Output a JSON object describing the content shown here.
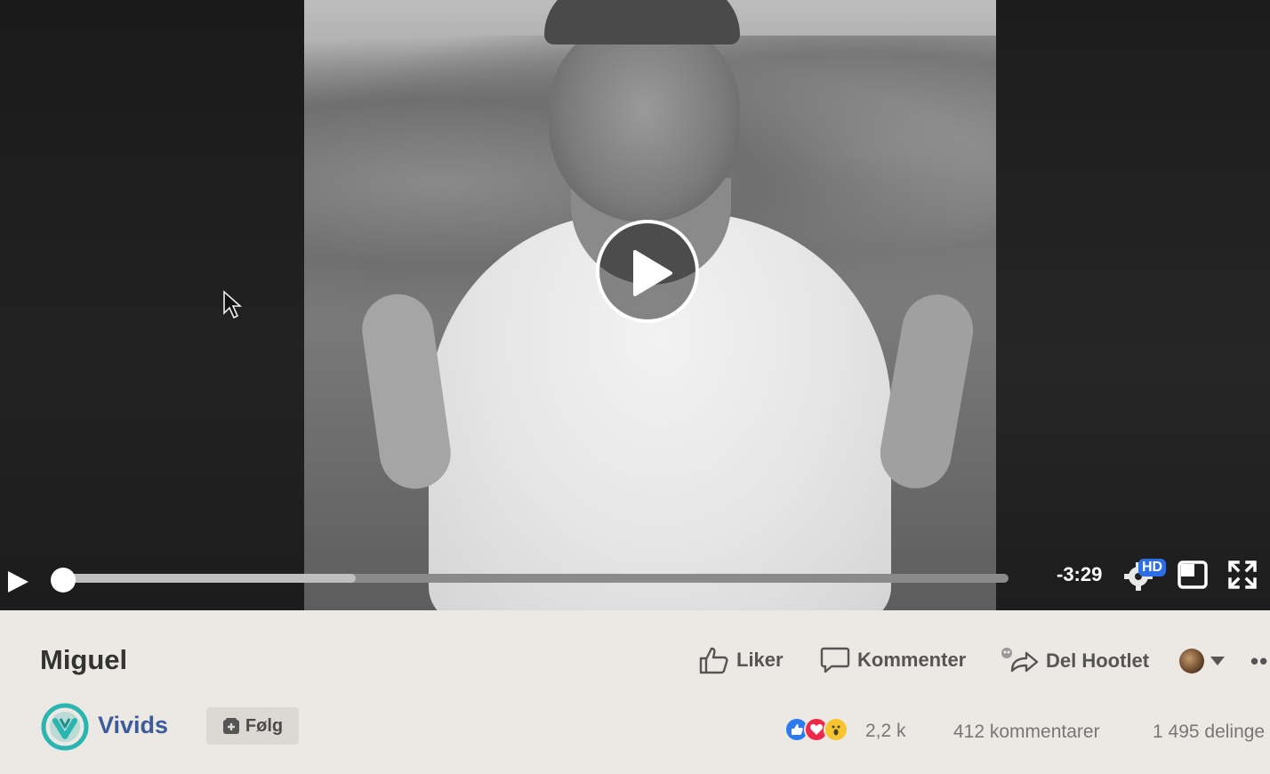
{
  "video": {
    "time_remaining": "-3:29",
    "hd_label": "HD",
    "progress_fraction": 0.0,
    "buffered_fraction": 0.31
  },
  "post": {
    "title": "Miguel",
    "actions": {
      "like": "Liker",
      "comment": "Kommenter",
      "share": "Del Hootlet"
    }
  },
  "page": {
    "name": "Vivids",
    "follow_label": "Følg",
    "brand_color": "#2bb5b0"
  },
  "stats": {
    "reactions": "2,2 k",
    "comments": "412 kommentarer",
    "shares": "1 495 delinge"
  },
  "icons": {
    "reactions": [
      "like-reaction-icon",
      "love-reaction-icon",
      "wow-reaction-icon"
    ]
  }
}
